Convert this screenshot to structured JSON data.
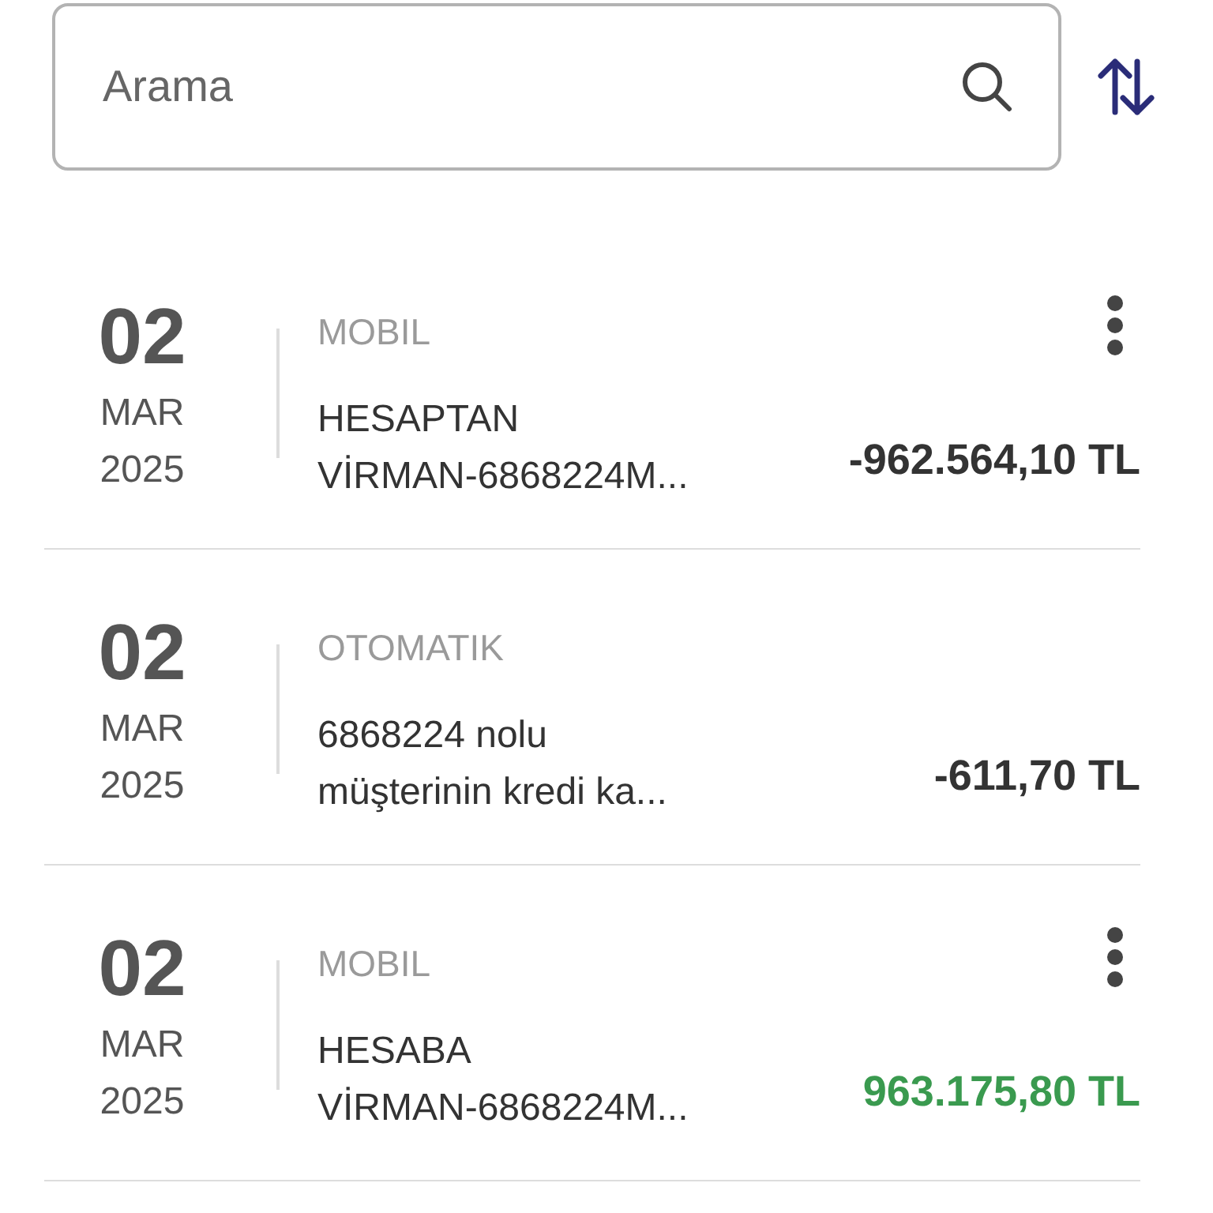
{
  "search": {
    "placeholder": "Arama"
  },
  "transactions": [
    {
      "day": "02",
      "month": "MAR",
      "year": "2025",
      "channel": "MOBIL",
      "description": [
        "HESAPTAN",
        "VİRMAN-6868224M..."
      ],
      "amount": "-962.564,10 TL",
      "kind": "debit",
      "has_menu": true
    },
    {
      "day": "02",
      "month": "MAR",
      "year": "2025",
      "channel": "OTOMATIK",
      "description": [
        "6868224 nolu",
        "müşterinin kredi ka..."
      ],
      "amount": "-611,70 TL",
      "kind": "debit",
      "has_menu": false
    },
    {
      "day": "02",
      "month": "MAR",
      "year": "2025",
      "channel": "MOBIL",
      "description": [
        "HESABA",
        "VİRMAN-6868224M..."
      ],
      "amount": "963.175,80 TL",
      "kind": "credit",
      "has_menu": true
    }
  ]
}
